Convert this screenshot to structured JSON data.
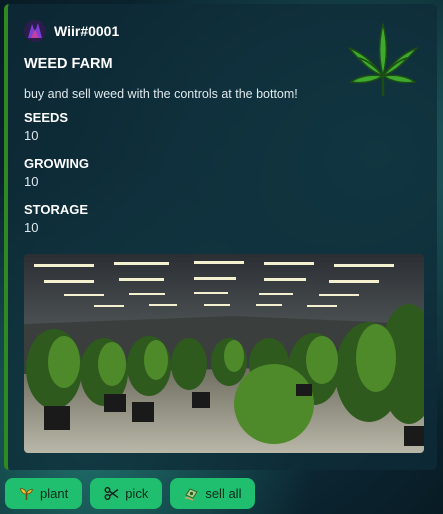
{
  "embed": {
    "author_name": "Wiir#0001",
    "title": "WEED FARM",
    "description": "buy and sell weed with the controls at the bottom!",
    "accent_color": "#2f8a1f",
    "thumbnail_icon": "cannabis-leaf-icon",
    "fields": [
      {
        "name": "SEEDS",
        "value": "10"
      },
      {
        "name": "GROWING",
        "value": "10"
      },
      {
        "name": "STORAGE",
        "value": "10"
      }
    ],
    "image_subject": "grow-room-photo"
  },
  "buttons": [
    {
      "label": "plant",
      "icon": "sprout-icon"
    },
    {
      "label": "pick",
      "icon": "scissors-icon"
    },
    {
      "label": "sell all",
      "icon": "money-icon"
    }
  ],
  "button_color": "#1fbf6f"
}
